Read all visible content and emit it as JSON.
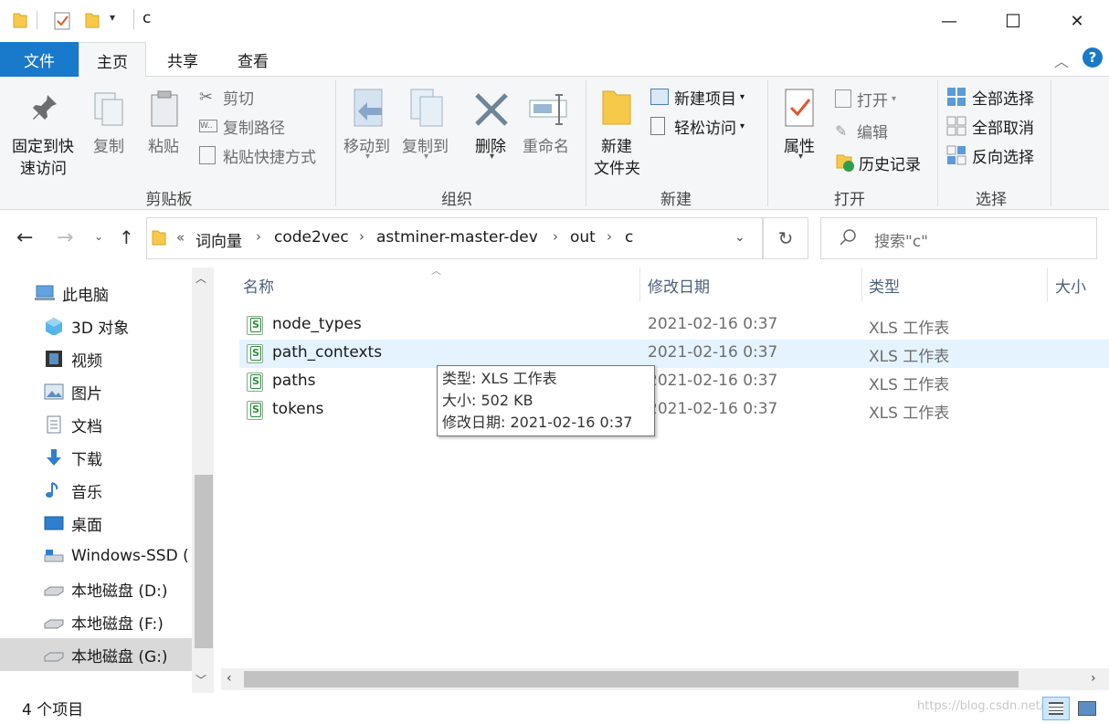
{
  "window": {
    "title": "c",
    "controls": {
      "minimize": "—",
      "maximize": "☐",
      "close": "✕"
    }
  },
  "tabs": {
    "file": "文件",
    "home": "主页",
    "share": "共享",
    "view": "查看"
  },
  "ribbon": {
    "clipboard": {
      "group": "剪贴板",
      "pin_line1": "固定到快",
      "pin_line2": "速访问",
      "copy": "复制",
      "paste": "粘贴",
      "cut": "剪切",
      "copy_path": "复制路径",
      "paste_shortcut": "粘贴快捷方式"
    },
    "organize": {
      "group": "组织",
      "move_to": "移动到",
      "copy_to": "复制到",
      "delete": "删除",
      "rename": "重命名"
    },
    "new": {
      "group": "新建",
      "new_folder_line1": "新建",
      "new_folder_line2": "文件夹",
      "new_item": "新建项目",
      "easy_access": "轻松访问"
    },
    "open": {
      "group": "打开",
      "properties": "属性",
      "open": "打开",
      "edit": "编辑",
      "history": "历史记录"
    },
    "select": {
      "group": "选择",
      "select_all": "全部选择",
      "select_none": "全部取消",
      "invert": "反向选择"
    }
  },
  "address": {
    "overflow": "«",
    "breadcrumbs": [
      "词向量",
      "code2vec",
      "astminer-master-dev",
      "out",
      "c"
    ],
    "search_placeholder": "搜索\"c\""
  },
  "nav": {
    "items": [
      {
        "label": "此电脑",
        "icon": "computer-icon"
      },
      {
        "label": "3D 对象",
        "icon": "cube-icon"
      },
      {
        "label": "视频",
        "icon": "video-icon"
      },
      {
        "label": "图片",
        "icon": "picture-icon"
      },
      {
        "label": "文档",
        "icon": "document-icon"
      },
      {
        "label": "下载",
        "icon": "download-icon"
      },
      {
        "label": "音乐",
        "icon": "music-icon"
      },
      {
        "label": "桌面",
        "icon": "desktop-icon"
      },
      {
        "label": "Windows-SSD (",
        "icon": "drive-icon"
      },
      {
        "label": "本地磁盘 (D:)",
        "icon": "drive-icon"
      },
      {
        "label": "本地磁盘 (F:)",
        "icon": "drive-icon"
      },
      {
        "label": "本地磁盘 (G:)",
        "icon": "drive-icon"
      }
    ]
  },
  "files": {
    "columns": {
      "name": "名称",
      "modified": "修改日期",
      "type": "类型",
      "size": "大小"
    },
    "rows": [
      {
        "name": "node_types",
        "modified": "2021-02-16 0:37",
        "type": "XLS 工作表"
      },
      {
        "name": "path_contexts",
        "modified": "2021-02-16 0:37",
        "type": "XLS 工作表"
      },
      {
        "name": "paths",
        "modified": "2021-02-16 0:37",
        "type": "XLS 工作表"
      },
      {
        "name": "tokens",
        "modified": "2021-02-16 0:37",
        "type": "XLS 工作表"
      }
    ]
  },
  "tooltip": {
    "type": "类型: XLS 工作表",
    "size": "大小: 502 KB",
    "modified": "修改日期: 2021-02-16 0:37"
  },
  "status": {
    "count": "4 个项目"
  },
  "watermark": "https://blog.csdn.net/..."
}
